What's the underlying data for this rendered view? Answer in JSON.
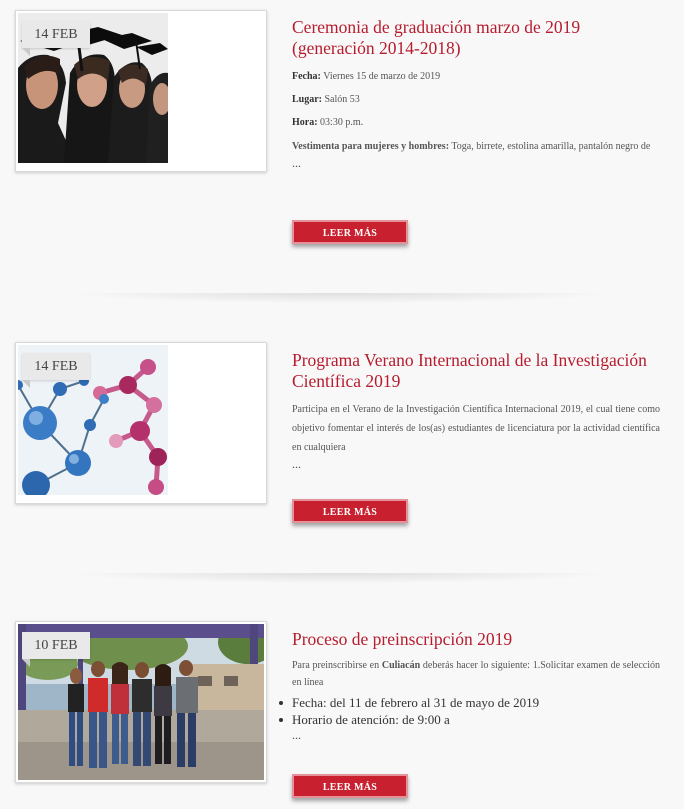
{
  "posts": [
    {
      "date": "14 FEB",
      "title": "Ceremonia de graduación marzo de 2019 (generación 2014-2018)",
      "meta": [
        {
          "label": "Fecha:",
          "value": "Viernes 15 de marzo de 2019"
        },
        {
          "label": "Lugar:",
          "value": "Salón 53"
        },
        {
          "label": "Hora:",
          "value": "03:30 p.m."
        }
      ],
      "dress_label": "Vestimenta para mujeres y hombres:",
      "dress_value": "Toga, birrete, estolina amarilla, pantalón negro de",
      "ellipsis": "...",
      "button": "LEER MÁS",
      "image": "graduates-photo"
    },
    {
      "date": "14 FEB",
      "title": "Programa Verano Internacional de la Investigación Científica 2019",
      "excerpt": "Participa en el Verano de la Investigación Científica Internacional 2019, el cual tiene como objetivo fomentar el interés de los(as) estudiantes de licenciatura por la actividad científica en cualquiera",
      "ellipsis": "...",
      "button": "LEER MÁS",
      "image": "molecules-illustration"
    },
    {
      "date": "10 FEB",
      "title": "Proceso de preinscripción 2019",
      "excerpt_before": "Para preinscribirse en",
      "excerpt_bold": "Culiacán",
      "excerpt_after": "deberás hacer lo siguiente: 1.Solicitar examen de selección en línea",
      "bullets": [
        "Fecha: del 11 de febrero al 31 de mayo de 2019",
        "Horario de atención: de 9:00 a"
      ],
      "ellipsis": "...",
      "button": "LEER MÁS",
      "image": "students-group-photo"
    }
  ]
}
